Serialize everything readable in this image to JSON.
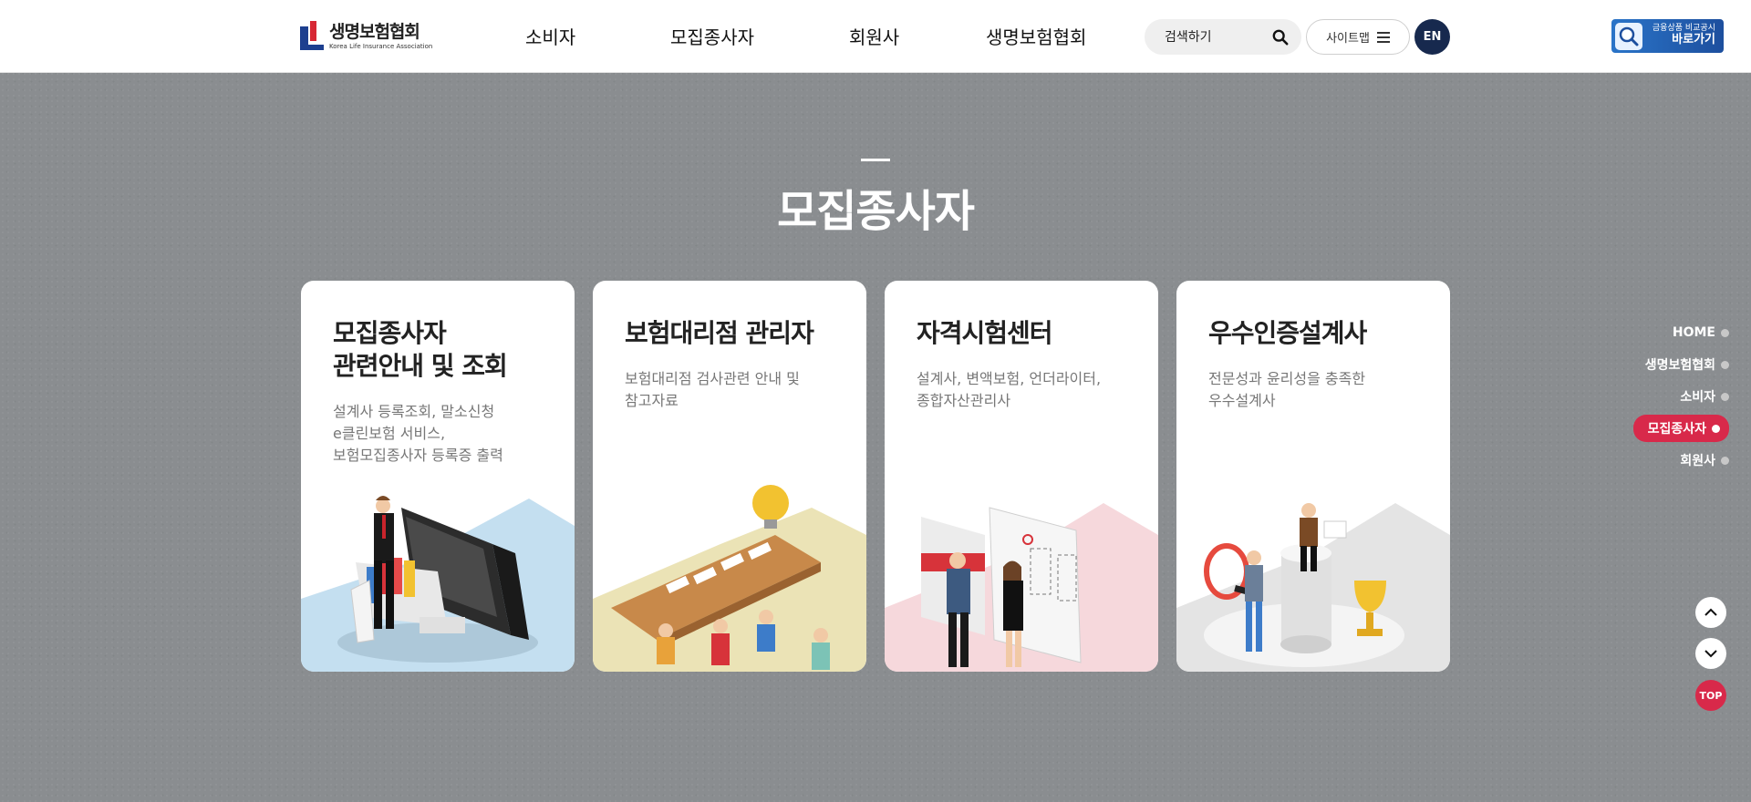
{
  "header": {
    "logo_main": "생명보험협회",
    "logo_sub": "Korea Life Insurance Association",
    "nav": [
      "소비자",
      "모집종사자",
      "회원사",
      "생명보험협회"
    ],
    "search_placeholder": "검색하기",
    "sitemap_label": "사이트맵",
    "lang_label": "EN",
    "compare_small": "금융상품 비교공시",
    "compare_big": "바로가기"
  },
  "section": {
    "title": "모집종사자"
  },
  "cards": [
    {
      "title_line1": "모집종사자",
      "title_line2": "관련안내 및 조회",
      "desc": [
        "설계사 등록조회, 말소신청",
        "e클린보험 서비스,",
        "보험모집종사자 등록증 출력"
      ],
      "art_color": "#c4dff0"
    },
    {
      "title_line1": "보험대리점 관리자",
      "desc": [
        "보험대리점 검사관련 안내 및",
        "참고자료"
      ],
      "art_color": "#ebe3b6"
    },
    {
      "title_line1": "자격시험센터",
      "desc": [
        "설계사, 변액보험, 언더라이터,",
        "종합자산관리사"
      ],
      "art_color": "#f6d8dc"
    },
    {
      "title_line1": "우수인증설계사",
      "desc": [
        "전문성과 윤리성을 충족한",
        "우수설계사"
      ],
      "art_color": "#e4e4e4"
    }
  ],
  "side_nav": {
    "items": [
      "HOME",
      "생명보험협회",
      "소비자",
      "모집종사자",
      "회원사"
    ],
    "active": "모집종사자",
    "top_label": "TOP"
  },
  "colors": {
    "accent_red": "#d8294a",
    "navy": "#17294e",
    "background": "#8a8d90"
  }
}
